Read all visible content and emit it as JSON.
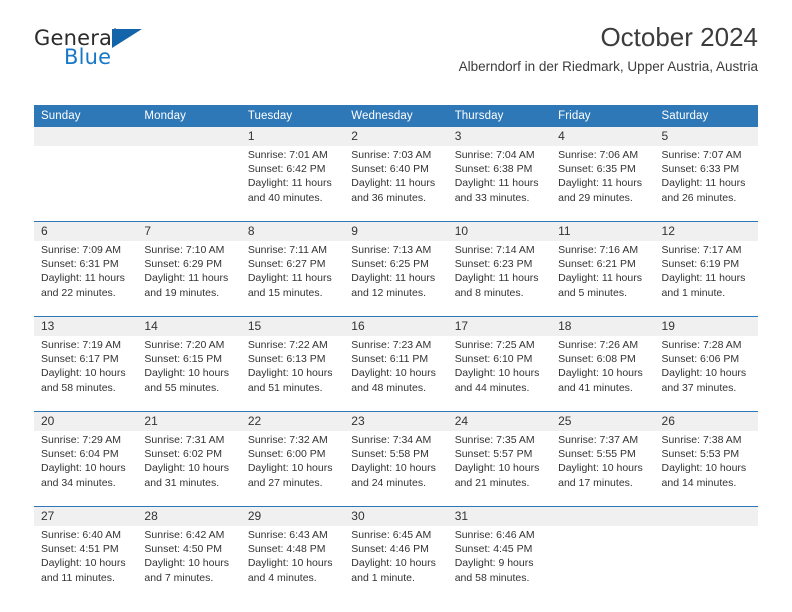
{
  "brand": {
    "name_part1": "General",
    "name_part2": "Blue",
    "triangle_color": "#1464aa",
    "blue_text_color": "#1878c8"
  },
  "header": {
    "title": "October 2024",
    "subtitle": "Alberndorf in der Riedmark, Upper Austria, Austria"
  },
  "theme": {
    "header_bar_color": "#2e78b8",
    "daynum_band_color": "#f0f0f0",
    "text_color": "#333333"
  },
  "weekday_headers": [
    "Sunday",
    "Monday",
    "Tuesday",
    "Wednesday",
    "Thursday",
    "Friday",
    "Saturday"
  ],
  "weeks": [
    {
      "days": [
        {
          "num": "",
          "sunrise": "",
          "sunset": "",
          "daylight_a": "",
          "daylight_b": ""
        },
        {
          "num": "",
          "sunrise": "",
          "sunset": "",
          "daylight_a": "",
          "daylight_b": ""
        },
        {
          "num": "1",
          "sunrise": "Sunrise: 7:01 AM",
          "sunset": "Sunset: 6:42 PM",
          "daylight_a": "Daylight: 11 hours",
          "daylight_b": "and 40 minutes."
        },
        {
          "num": "2",
          "sunrise": "Sunrise: 7:03 AM",
          "sunset": "Sunset: 6:40 PM",
          "daylight_a": "Daylight: 11 hours",
          "daylight_b": "and 36 minutes."
        },
        {
          "num": "3",
          "sunrise": "Sunrise: 7:04 AM",
          "sunset": "Sunset: 6:38 PM",
          "daylight_a": "Daylight: 11 hours",
          "daylight_b": "and 33 minutes."
        },
        {
          "num": "4",
          "sunrise": "Sunrise: 7:06 AM",
          "sunset": "Sunset: 6:35 PM",
          "daylight_a": "Daylight: 11 hours",
          "daylight_b": "and 29 minutes."
        },
        {
          "num": "5",
          "sunrise": "Sunrise: 7:07 AM",
          "sunset": "Sunset: 6:33 PM",
          "daylight_a": "Daylight: 11 hours",
          "daylight_b": "and 26 minutes."
        }
      ]
    },
    {
      "days": [
        {
          "num": "6",
          "sunrise": "Sunrise: 7:09 AM",
          "sunset": "Sunset: 6:31 PM",
          "daylight_a": "Daylight: 11 hours",
          "daylight_b": "and 22 minutes."
        },
        {
          "num": "7",
          "sunrise": "Sunrise: 7:10 AM",
          "sunset": "Sunset: 6:29 PM",
          "daylight_a": "Daylight: 11 hours",
          "daylight_b": "and 19 minutes."
        },
        {
          "num": "8",
          "sunrise": "Sunrise: 7:11 AM",
          "sunset": "Sunset: 6:27 PM",
          "daylight_a": "Daylight: 11 hours",
          "daylight_b": "and 15 minutes."
        },
        {
          "num": "9",
          "sunrise": "Sunrise: 7:13 AM",
          "sunset": "Sunset: 6:25 PM",
          "daylight_a": "Daylight: 11 hours",
          "daylight_b": "and 12 minutes."
        },
        {
          "num": "10",
          "sunrise": "Sunrise: 7:14 AM",
          "sunset": "Sunset: 6:23 PM",
          "daylight_a": "Daylight: 11 hours",
          "daylight_b": "and 8 minutes."
        },
        {
          "num": "11",
          "sunrise": "Sunrise: 7:16 AM",
          "sunset": "Sunset: 6:21 PM",
          "daylight_a": "Daylight: 11 hours",
          "daylight_b": "and 5 minutes."
        },
        {
          "num": "12",
          "sunrise": "Sunrise: 7:17 AM",
          "sunset": "Sunset: 6:19 PM",
          "daylight_a": "Daylight: 11 hours",
          "daylight_b": "and 1 minute."
        }
      ]
    },
    {
      "days": [
        {
          "num": "13",
          "sunrise": "Sunrise: 7:19 AM",
          "sunset": "Sunset: 6:17 PM",
          "daylight_a": "Daylight: 10 hours",
          "daylight_b": "and 58 minutes."
        },
        {
          "num": "14",
          "sunrise": "Sunrise: 7:20 AM",
          "sunset": "Sunset: 6:15 PM",
          "daylight_a": "Daylight: 10 hours",
          "daylight_b": "and 55 minutes."
        },
        {
          "num": "15",
          "sunrise": "Sunrise: 7:22 AM",
          "sunset": "Sunset: 6:13 PM",
          "daylight_a": "Daylight: 10 hours",
          "daylight_b": "and 51 minutes."
        },
        {
          "num": "16",
          "sunrise": "Sunrise: 7:23 AM",
          "sunset": "Sunset: 6:11 PM",
          "daylight_a": "Daylight: 10 hours",
          "daylight_b": "and 48 minutes."
        },
        {
          "num": "17",
          "sunrise": "Sunrise: 7:25 AM",
          "sunset": "Sunset: 6:10 PM",
          "daylight_a": "Daylight: 10 hours",
          "daylight_b": "and 44 minutes."
        },
        {
          "num": "18",
          "sunrise": "Sunrise: 7:26 AM",
          "sunset": "Sunset: 6:08 PM",
          "daylight_a": "Daylight: 10 hours",
          "daylight_b": "and 41 minutes."
        },
        {
          "num": "19",
          "sunrise": "Sunrise: 7:28 AM",
          "sunset": "Sunset: 6:06 PM",
          "daylight_a": "Daylight: 10 hours",
          "daylight_b": "and 37 minutes."
        }
      ]
    },
    {
      "days": [
        {
          "num": "20",
          "sunrise": "Sunrise: 7:29 AM",
          "sunset": "Sunset: 6:04 PM",
          "daylight_a": "Daylight: 10 hours",
          "daylight_b": "and 34 minutes."
        },
        {
          "num": "21",
          "sunrise": "Sunrise: 7:31 AM",
          "sunset": "Sunset: 6:02 PM",
          "daylight_a": "Daylight: 10 hours",
          "daylight_b": "and 31 minutes."
        },
        {
          "num": "22",
          "sunrise": "Sunrise: 7:32 AM",
          "sunset": "Sunset: 6:00 PM",
          "daylight_a": "Daylight: 10 hours",
          "daylight_b": "and 27 minutes."
        },
        {
          "num": "23",
          "sunrise": "Sunrise: 7:34 AM",
          "sunset": "Sunset: 5:58 PM",
          "daylight_a": "Daylight: 10 hours",
          "daylight_b": "and 24 minutes."
        },
        {
          "num": "24",
          "sunrise": "Sunrise: 7:35 AM",
          "sunset": "Sunset: 5:57 PM",
          "daylight_a": "Daylight: 10 hours",
          "daylight_b": "and 21 minutes."
        },
        {
          "num": "25",
          "sunrise": "Sunrise: 7:37 AM",
          "sunset": "Sunset: 5:55 PM",
          "daylight_a": "Daylight: 10 hours",
          "daylight_b": "and 17 minutes."
        },
        {
          "num": "26",
          "sunrise": "Sunrise: 7:38 AM",
          "sunset": "Sunset: 5:53 PM",
          "daylight_a": "Daylight: 10 hours",
          "daylight_b": "and 14 minutes."
        }
      ]
    },
    {
      "days": [
        {
          "num": "27",
          "sunrise": "Sunrise: 6:40 AM",
          "sunset": "Sunset: 4:51 PM",
          "daylight_a": "Daylight: 10 hours",
          "daylight_b": "and 11 minutes."
        },
        {
          "num": "28",
          "sunrise": "Sunrise: 6:42 AM",
          "sunset": "Sunset: 4:50 PM",
          "daylight_a": "Daylight: 10 hours",
          "daylight_b": "and 7 minutes."
        },
        {
          "num": "29",
          "sunrise": "Sunrise: 6:43 AM",
          "sunset": "Sunset: 4:48 PM",
          "daylight_a": "Daylight: 10 hours",
          "daylight_b": "and 4 minutes."
        },
        {
          "num": "30",
          "sunrise": "Sunrise: 6:45 AM",
          "sunset": "Sunset: 4:46 PM",
          "daylight_a": "Daylight: 10 hours",
          "daylight_b": "and 1 minute."
        },
        {
          "num": "31",
          "sunrise": "Sunrise: 6:46 AM",
          "sunset": "Sunset: 4:45 PM",
          "daylight_a": "Daylight: 9 hours",
          "daylight_b": "and 58 minutes."
        },
        {
          "num": "",
          "sunrise": "",
          "sunset": "",
          "daylight_a": "",
          "daylight_b": ""
        },
        {
          "num": "",
          "sunrise": "",
          "sunset": "",
          "daylight_a": "",
          "daylight_b": ""
        }
      ]
    }
  ]
}
